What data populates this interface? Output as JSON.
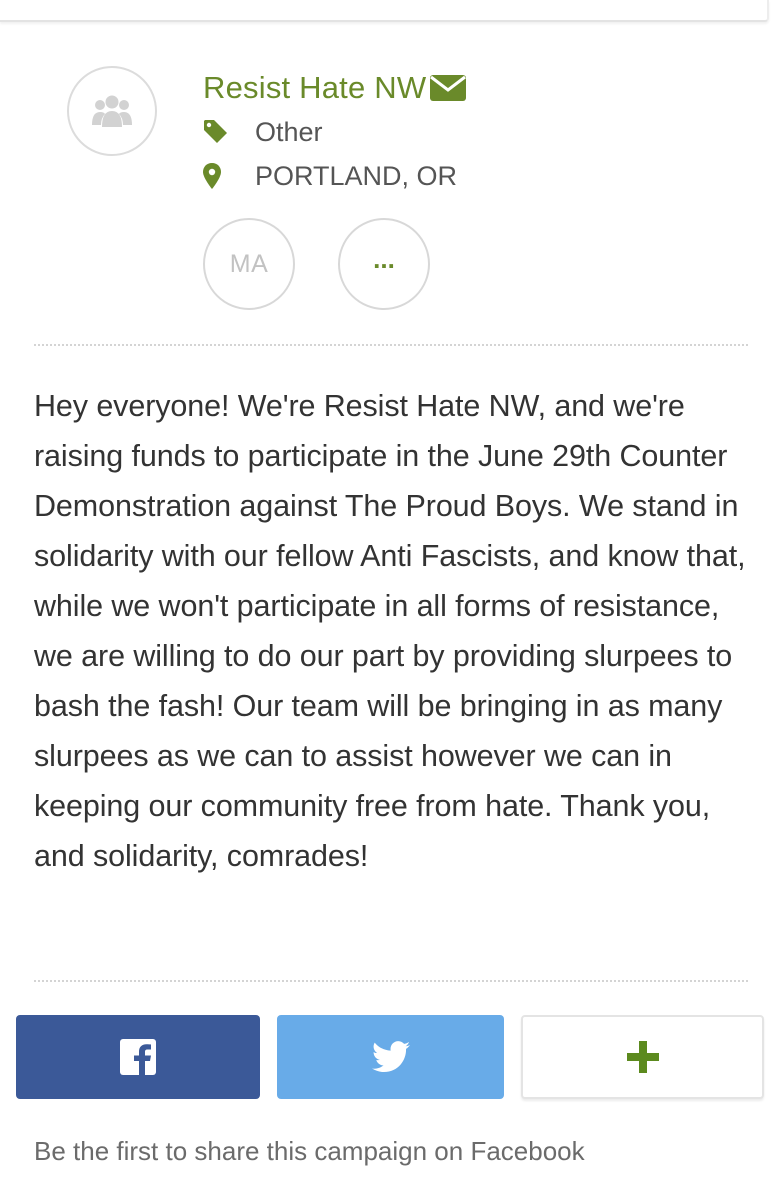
{
  "organizer": {
    "name": "Resist Hate NW",
    "category": "Other",
    "location": "PORTLAND, OR",
    "avatar_icon": "group-icon",
    "contact_icon": "envelope-icon",
    "category_icon": "tag-icon",
    "location_icon": "map-pin-icon"
  },
  "team": {
    "member_initials": "MA",
    "more_label": "..."
  },
  "story": {
    "text": "Hey everyone! We're Resist Hate NW, and we're raising funds to participate in the June 29th Counter Demonstration against The Proud Boys. We stand in solidarity with our fellow Anti Fascists, and know that, while we won't participate in all forms of resistance, we are willing to do our part by providing slurpees to bash the fash! Our team will be bringing in as many slurpees as we can to assist however we can in keeping our community free from hate. Thank you, and solidarity, comrades!"
  },
  "share": {
    "facebook_icon": "facebook-icon",
    "twitter_icon": "twitter-icon",
    "more_icon": "plus-icon",
    "note": "Be the first to share this campaign on Facebook"
  },
  "colors": {
    "accent_green": "#6a8a2a",
    "facebook_blue": "#3b5998",
    "twitter_blue": "#68abe8"
  }
}
